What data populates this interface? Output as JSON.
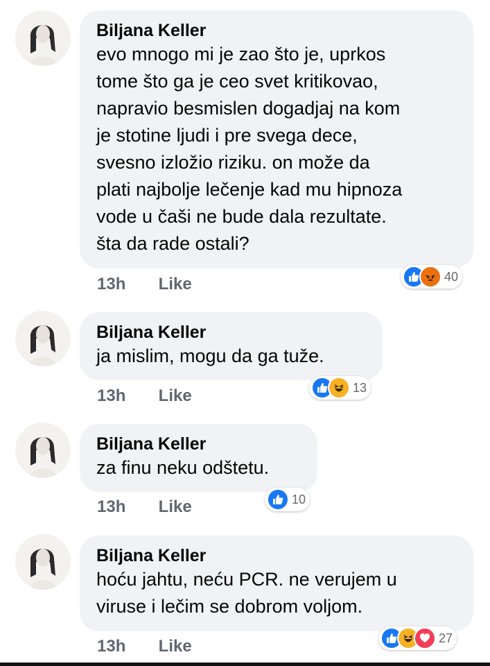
{
  "comments": [
    {
      "author": "Biljana Keller",
      "lines": [
        "evo mnogo mi je zao što je, uprkos",
        "tome što ga je ceo svet kritikovao,",
        "napravio besmislen dogadjaj na kom",
        "je stotine ljudi i pre svega dece,",
        "svesno izložio riziku. on može da",
        "plati najbolje lečenje kad mu hipnoza",
        "vode u čaši ne bude dala rezultate.",
        "šta da rade ostali?"
      ],
      "time": "13h",
      "like_label": "Like",
      "reactions": [
        "like",
        "angry"
      ],
      "reaction_count": "40"
    },
    {
      "author": "Biljana Keller",
      "lines": [
        "ja mislim, mogu da ga tuže."
      ],
      "time": "13h",
      "like_label": "Like",
      "reactions": [
        "like",
        "haha"
      ],
      "reaction_count": "13"
    },
    {
      "author": "Biljana Keller",
      "lines": [
        "za finu neku odštetu."
      ],
      "time": "13h",
      "like_label": "Like",
      "reactions": [
        "like"
      ],
      "reaction_count": "10"
    },
    {
      "author": "Biljana Keller",
      "lines": [
        "hoću jahtu, neću PCR. ne verujem u",
        "viruse i lečim se dobrom voljom."
      ],
      "time": "13h",
      "like_label": "Like",
      "reactions": [
        "like",
        "haha",
        "love"
      ],
      "reaction_count": "27"
    }
  ],
  "colors": {
    "bubble": "#f0f2f5",
    "like": "#1877f2",
    "angry": "#e9710f",
    "haha": "#f7b125",
    "love": "#f33e58",
    "meta": "#606770"
  }
}
